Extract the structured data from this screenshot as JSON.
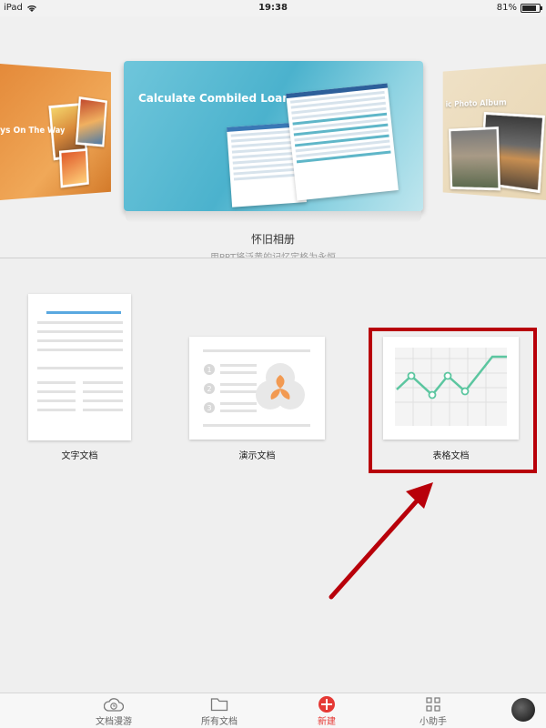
{
  "status_bar": {
    "device": "iPad",
    "time": "19:38",
    "battery": "81%",
    "battery_level": 0.81
  },
  "carousel": {
    "left_card_text": "ys On The Way",
    "main_card": {
      "heading": "Calculate Combiled Loan",
      "title": "怀旧相册",
      "subtitle": "用PPT将泛黄的记忆定格为永恒"
    },
    "right_card_text": "ic Photo Album"
  },
  "templates": [
    {
      "label": "文字文档",
      "icon": "word-document-thumbnail"
    },
    {
      "label": "演示文档",
      "icon": "presentation-thumbnail"
    },
    {
      "label": "表格文档",
      "icon": "spreadsheet-chart-thumbnail"
    }
  ],
  "tabbar": {
    "items": [
      {
        "label": "文档漫游",
        "icon": "cloud-clock-icon"
      },
      {
        "label": "所有文档",
        "icon": "folder-icon"
      },
      {
        "label": "新建",
        "icon": "add-circle-icon",
        "active": true
      },
      {
        "label": "小助手",
        "icon": "grid-icon"
      }
    ]
  },
  "colors": {
    "accent": "#e53935",
    "highlight_box": "#b8000a",
    "arrow": "#b8000a",
    "chart_line": "#5cc6a0",
    "chart_rule": "#5aa8e0"
  }
}
